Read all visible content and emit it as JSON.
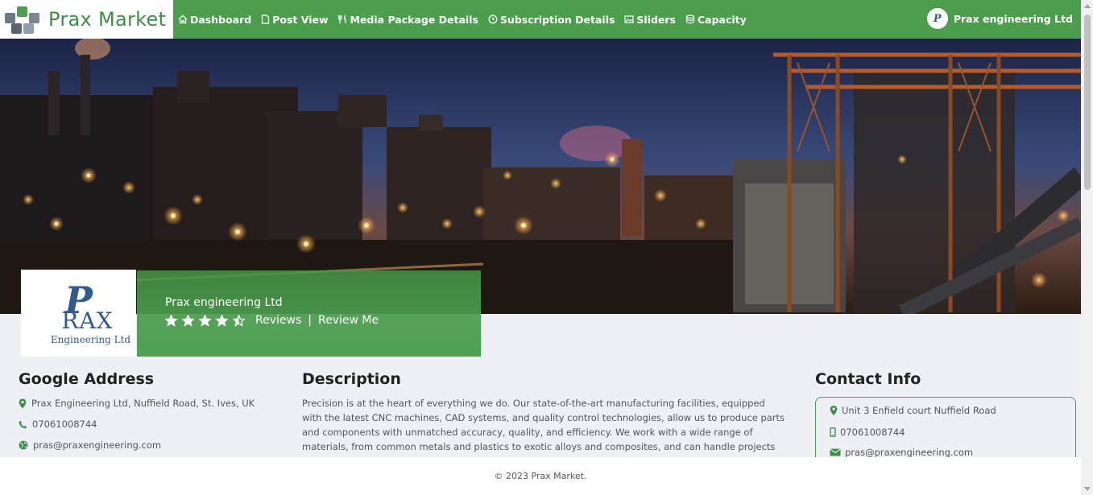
{
  "brand": {
    "name": "Prax Market"
  },
  "nav": [
    {
      "label": "Dashboard",
      "icon": "home-icon"
    },
    {
      "label": "Post View",
      "icon": "document-icon"
    },
    {
      "label": "Media Package Details",
      "icon": "utensils-icon"
    },
    {
      "label": "Subscription Details",
      "icon": "clock-icon"
    },
    {
      "label": "Sliders",
      "icon": "image-icon"
    },
    {
      "label": "Capacity",
      "icon": "database-icon"
    }
  ],
  "user": {
    "name": "Prax engineering Ltd",
    "avatar_text": "P"
  },
  "profile": {
    "logo": {
      "p": "P",
      "rax": "RAX",
      "sub": "Engineering Ltd"
    },
    "company_name": "Prax engineering Ltd",
    "rating": 4.5,
    "reviews_label": "Reviews",
    "separator": "|",
    "review_me_label": "Review Me"
  },
  "google_address": {
    "title": "Google Address",
    "address": "Prax Engineering Ltd, Nuffield Road, St. Ives, UK",
    "phone": "07061008744",
    "email": "pras@praxengineering.com"
  },
  "description": {
    "title": "Description",
    "text": "Precision is at the heart of everything we do. Our state-of-the-art manufacturing facilities, equipped with the latest CNC machines, CAD systems, and quality control technologies, allow us to produce parts and components with unmatched accuracy, quality, and efficiency. We work with a wide range of materials, from common metals and plastics to exotic alloys and composites, and can handle projects of any size"
  },
  "contact": {
    "title": "Contact Info",
    "address": "Unit 3 Enfield court Nuffield Road",
    "phone": "07061008744",
    "email": "pras@praxengineering.com"
  },
  "footer": {
    "text": "© 2023 Prax Market."
  },
  "colors": {
    "primary": "#4a9e4c",
    "brand_text": "#3d8f47",
    "logo_blue": "#2f5b8f"
  }
}
